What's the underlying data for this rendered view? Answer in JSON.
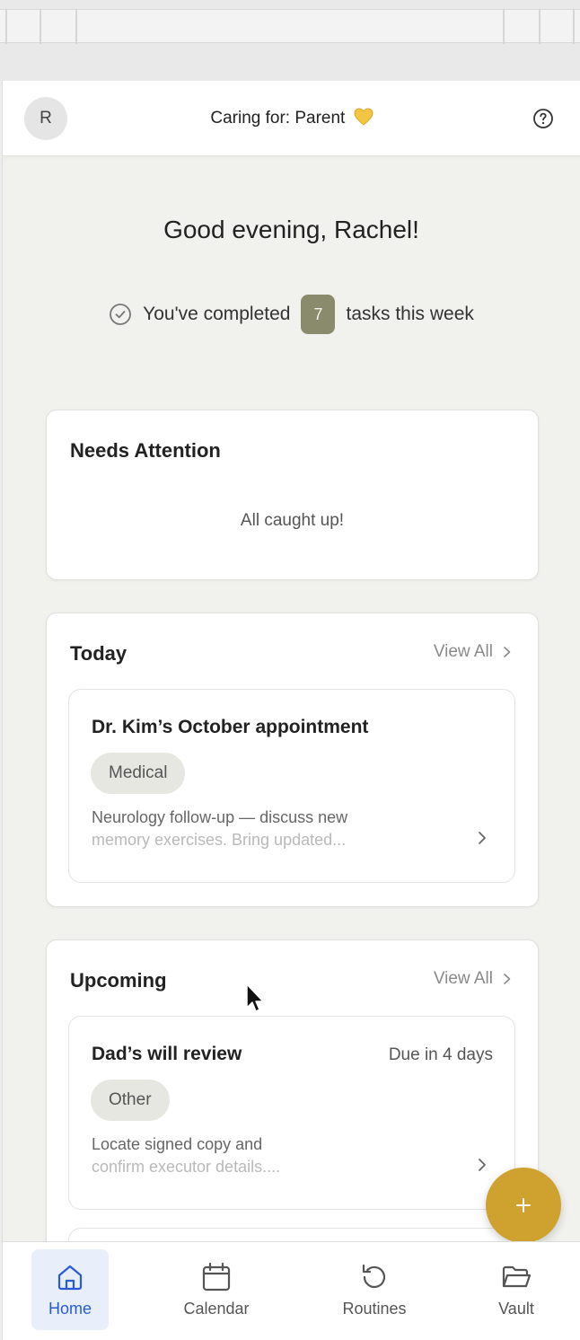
{
  "header": {
    "avatar_initial": "R",
    "caring_for": "Caring for: Parent"
  },
  "greeting": "Good evening, Rachel!",
  "completed": {
    "prefix": "You've completed",
    "count": "7",
    "suffix": "tasks this week"
  },
  "needs_attention": {
    "title": "Needs Attention",
    "empty_text": "All caught up!"
  },
  "today": {
    "title": "Today",
    "view_all": "View All",
    "tasks": [
      {
        "title": "Dr. Kim’s October appointment",
        "category": "Medical",
        "description_line1": "Neurology follow-up — discuss new",
        "description_line2": "memory exercises. Bring updated..."
      }
    ]
  },
  "upcoming": {
    "title": "Upcoming",
    "view_all": "View All",
    "tasks": [
      {
        "title": "Dad’s will review",
        "due": "Due in 4 days",
        "category": "Other",
        "description_line1": "Locate signed copy and",
        "description_line2": "confirm executor details...."
      }
    ]
  },
  "bottom_nav": [
    {
      "label": "Home",
      "icon": "home-icon",
      "active": true
    },
    {
      "label": "Calendar",
      "icon": "calendar-icon",
      "active": false
    },
    {
      "label": "Routines",
      "icon": "routines-icon",
      "active": false
    },
    {
      "label": "Vault",
      "icon": "folder-icon",
      "active": false
    }
  ],
  "colors": {
    "accent_gold": "#cfa12e",
    "active_blue": "#2a5bd7",
    "badge_olive": "#8a8a6c",
    "background": "#f1f1ee"
  }
}
